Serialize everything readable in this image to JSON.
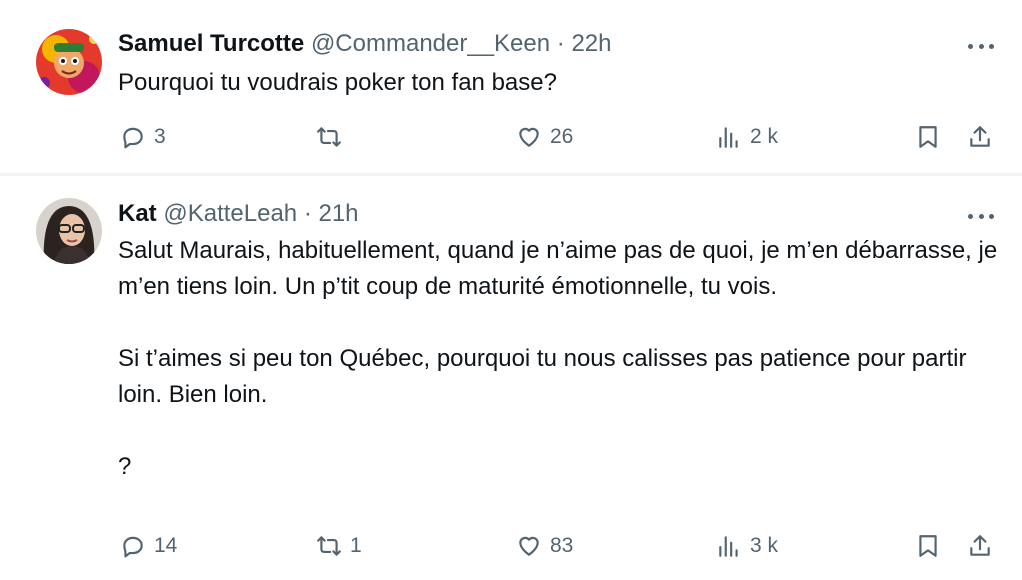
{
  "tweets": [
    {
      "display_name": "Samuel Turcotte",
      "handle": "@Commander__Keen",
      "separator": "·",
      "time": "22h",
      "text": "Pourquoi tu voudrais poker ton fan base?",
      "replies": "3",
      "retweets": "",
      "likes": "26",
      "views": "2 k"
    },
    {
      "display_name": "Kat",
      "handle": "@KatteLeah",
      "separator": "·",
      "time": "21h",
      "text": "Salut Maurais, habituellement, quand je n’aime pas de quoi, je m’en débarrasse, je m’en tiens loin. Un p’tit coup de maturité émotionnelle, tu vois.\n\nSi t’aimes si peu ton Québec, pourquoi tu nous calisses pas patience pour partir loin. Bien loin.\n\n?",
      "replies": "14",
      "retweets": "1",
      "likes": "83",
      "views": "3 k"
    }
  ],
  "icons": {
    "more": "more-horizontal-icon",
    "reply": "reply-icon",
    "retweet": "retweet-icon",
    "like": "heart-icon",
    "views": "views-icon",
    "bookmark": "bookmark-icon",
    "share": "share-icon"
  },
  "colors": {
    "text": "#0f1419",
    "secondary": "#536471",
    "divider": "#eff3f4"
  }
}
